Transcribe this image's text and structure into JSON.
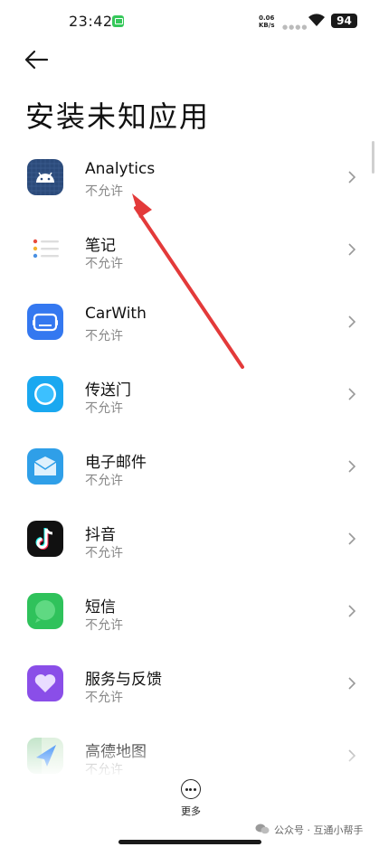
{
  "status_bar": {
    "time": "23:42",
    "net_speed_value": "0.06",
    "net_speed_unit": "KB/s",
    "battery": "94"
  },
  "page": {
    "title": "安装未知应用"
  },
  "apps": [
    {
      "name": "Analytics",
      "status": "不允许",
      "icon": "android-icon"
    },
    {
      "name": "笔记",
      "status": "不允许",
      "icon": "notes-icon"
    },
    {
      "name": "CarWith",
      "status": "不允许",
      "icon": "car-icon"
    },
    {
      "name": "传送门",
      "status": "不允许",
      "icon": "portal-icon"
    },
    {
      "name": "电子邮件",
      "status": "不允许",
      "icon": "mail-icon"
    },
    {
      "name": "抖音",
      "status": "不允许",
      "icon": "douyin-icon"
    },
    {
      "name": "短信",
      "status": "不允许",
      "icon": "sms-icon"
    },
    {
      "name": "服务与反馈",
      "status": "不允许",
      "icon": "heart-icon"
    },
    {
      "name": "高德地图",
      "status": "不允许",
      "icon": "amap-icon"
    }
  ],
  "bottom": {
    "more_label": "更多"
  },
  "watermark": {
    "text": "公众号 · 互通小帮手"
  },
  "colors": {
    "annotation_arrow": "#e33a3a",
    "status_text": "#888888"
  }
}
